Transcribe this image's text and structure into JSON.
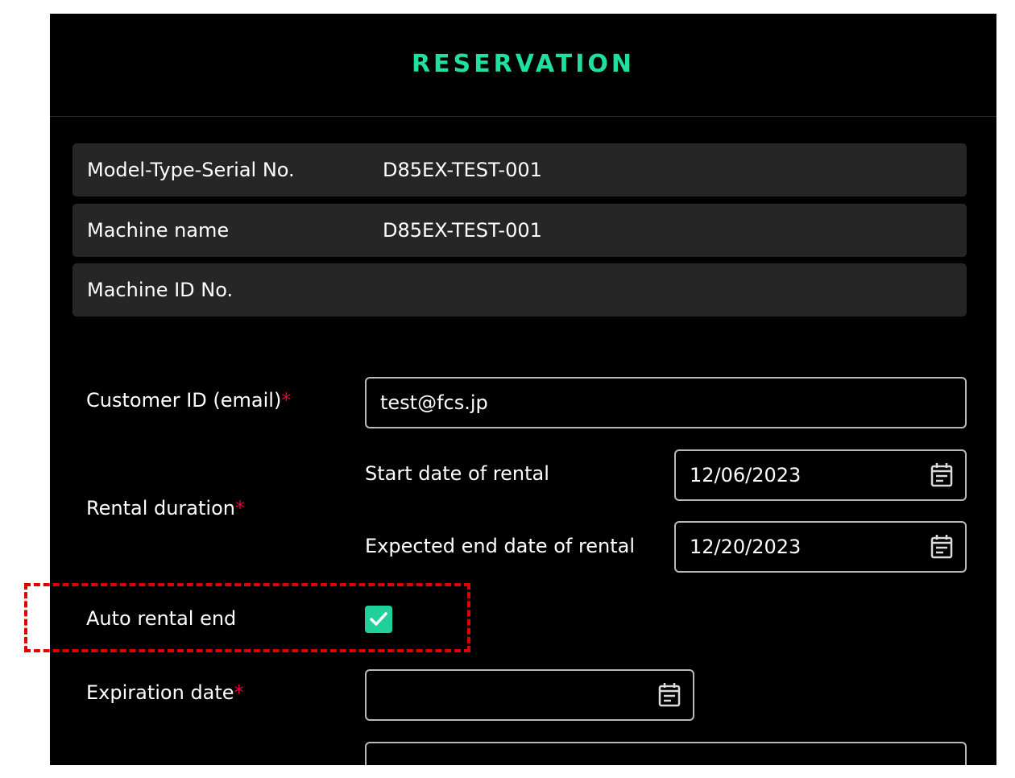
{
  "header": {
    "title": "RESERVATION"
  },
  "info": [
    {
      "label": "Model-Type-Serial No.",
      "value": "D85EX-TEST-001"
    },
    {
      "label": "Machine name",
      "value": "D85EX-TEST-001"
    },
    {
      "label": "Machine ID No.",
      "value": ""
    }
  ],
  "form": {
    "customer_id": {
      "label": "Customer ID (email)",
      "required_mark": "*",
      "value": "test@fcs.jp"
    },
    "rental_duration": {
      "label": "Rental duration",
      "required_mark": "*",
      "start_label": "Start date of rental",
      "start_value": "12/06/2023",
      "end_label": "Expected end date of rental",
      "end_value": "12/20/2023"
    },
    "auto_rental_end": {
      "label": "Auto rental end",
      "checked": true
    },
    "expiration_date": {
      "label": "Expiration date",
      "required_mark": "*",
      "value": ""
    }
  },
  "colors": {
    "accent": "#1fe0a0",
    "required": "#e0003a",
    "highlight": "#e00000",
    "panel": "#000000",
    "row": "#262626"
  },
  "icons": {
    "date_picker": "calendar-icon",
    "checkbox_mark": "check-icon"
  }
}
